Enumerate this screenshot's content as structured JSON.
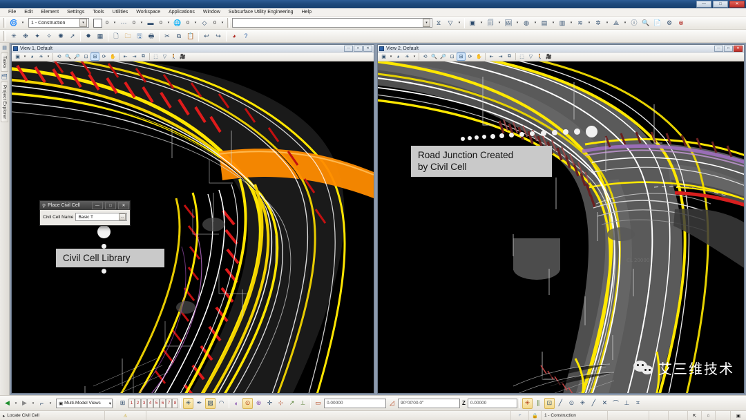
{
  "app": {
    "title": "",
    "window_controls": [
      "—",
      "□",
      "✕"
    ]
  },
  "menubar": {
    "items": [
      {
        "label": "File"
      },
      {
        "label": "Edit"
      },
      {
        "label": "Element"
      },
      {
        "label": "Settings"
      },
      {
        "label": "Tools"
      },
      {
        "label": "Utilities"
      },
      {
        "label": "Workspace"
      },
      {
        "label": "Applications"
      },
      {
        "label": "Window"
      },
      {
        "label": "Subsurface Utility Engineering"
      },
      {
        "label": "Help"
      }
    ]
  },
  "attributes_toolbar": {
    "active_level": "1 - Construction",
    "color_value": "0",
    "style_value": "0",
    "weight_value": "0",
    "class_value": "0",
    "transparency_value": "0",
    "search_value": "",
    "search_placeholder": ""
  },
  "standard_toolbar": {
    "buttons": [
      {
        "name": "element-selection-icon",
        "glyph": "✳"
      },
      {
        "name": "fence-icon",
        "glyph": "❉"
      },
      {
        "name": "select-by-attributes-icon",
        "glyph": "✦"
      },
      {
        "name": "powerselector-icon",
        "glyph": "✧"
      },
      {
        "name": "select-similar-icon",
        "glyph": "✺"
      },
      {
        "name": "pointer-icon",
        "glyph": "➚"
      },
      {
        "name": "pattern-icon",
        "glyph": "✸"
      },
      {
        "name": "grid-icon",
        "glyph": "▦"
      },
      {
        "name": "new-file-icon",
        "glyph": "🗋"
      },
      {
        "name": "open-file-icon",
        "glyph": "🗀"
      },
      {
        "name": "save-icon",
        "glyph": "🖫"
      },
      {
        "name": "print-icon",
        "glyph": "🖶"
      },
      {
        "name": "cut-icon",
        "glyph": "✂"
      },
      {
        "name": "copy-icon",
        "glyph": "⧉"
      },
      {
        "name": "paste-icon",
        "glyph": "📋"
      },
      {
        "name": "undo-icon",
        "glyph": "↩"
      },
      {
        "name": "redo-icon",
        "glyph": "↪"
      },
      {
        "name": "render-icon",
        "glyph": "◕"
      },
      {
        "name": "help-icon",
        "glyph": "?"
      }
    ]
  },
  "primary_toolbar": {
    "buttons": [
      {
        "name": "models-icon",
        "glyph": "▣"
      },
      {
        "name": "references-icon",
        "glyph": "🗐"
      },
      {
        "name": "raster-manager-icon",
        "glyph": "🖼"
      },
      {
        "name": "point-clouds-icon",
        "glyph": "◍"
      },
      {
        "name": "level-manager-icon",
        "glyph": "▤"
      },
      {
        "name": "level-display-icon",
        "glyph": "▥"
      },
      {
        "name": "element-info-icon",
        "glyph": "≋"
      },
      {
        "name": "cell-library-icon",
        "glyph": "✲"
      },
      {
        "name": "design-history-icon",
        "glyph": "⟁"
      },
      {
        "name": "info-icon",
        "glyph": "ⓘ"
      },
      {
        "name": "analyze-icon",
        "glyph": "🔍"
      },
      {
        "name": "report-icon",
        "glyph": "📄"
      },
      {
        "name": "settings-icon",
        "glyph": "⚙"
      },
      {
        "name": "clear-icon",
        "glyph": "⊗"
      }
    ]
  },
  "left_rail": {
    "tabs": [
      {
        "label": "Tasks",
        "icon": "tasks-icon"
      },
      {
        "label": "Project Explorer",
        "icon": "project-explorer-icon"
      }
    ]
  },
  "views": [
    {
      "id": "view1",
      "title": "View 1, Default",
      "controls": [
        "—",
        "□",
        "✕"
      ],
      "close_is_red": false,
      "toolbar": [
        {
          "name": "view-attributes-icon",
          "glyph": "▣"
        },
        {
          "name": "adjust-view-brightness-icon",
          "glyph": "◕"
        },
        {
          "name": "display-style-icon",
          "glyph": "☀"
        },
        {
          "name": "update-view-icon",
          "glyph": "⟲"
        },
        {
          "name": "zoom-in-icon",
          "glyph": "🔍"
        },
        {
          "name": "zoom-out-icon",
          "glyph": "🔎"
        },
        {
          "name": "window-area-icon",
          "glyph": "⊡"
        },
        {
          "name": "fit-view-icon",
          "glyph": "⊞"
        },
        {
          "name": "rotate-view-icon",
          "glyph": "⟳"
        },
        {
          "name": "pan-view-icon",
          "glyph": "✋"
        },
        {
          "name": "view-previous-icon",
          "glyph": "⇤"
        },
        {
          "name": "view-next-icon",
          "glyph": "⇥"
        },
        {
          "name": "copy-view-icon",
          "glyph": "⧉"
        },
        {
          "name": "clip-volume-icon",
          "glyph": "⬚"
        },
        {
          "name": "clip-mask-icon",
          "glyph": "▽"
        },
        {
          "name": "walk-icon",
          "glyph": "🚶"
        },
        {
          "name": "camera-icon",
          "glyph": "🎥"
        }
      ]
    },
    {
      "id": "view2",
      "title": "View 2, Default",
      "controls": [
        "—",
        "□",
        "✕"
      ],
      "close_is_red": true,
      "toolbar": [
        {
          "name": "view-attributes-icon",
          "glyph": "▣"
        },
        {
          "name": "adjust-view-brightness-icon",
          "glyph": "◕"
        },
        {
          "name": "display-style-icon",
          "glyph": "☀"
        },
        {
          "name": "update-view-icon",
          "glyph": "⟲"
        },
        {
          "name": "zoom-in-icon",
          "glyph": "🔍"
        },
        {
          "name": "zoom-out-icon",
          "glyph": "🔎"
        },
        {
          "name": "window-area-icon",
          "glyph": "⊡"
        },
        {
          "name": "fit-view-icon",
          "glyph": "⊞"
        },
        {
          "name": "rotate-view-icon",
          "glyph": "⟳"
        },
        {
          "name": "pan-view-icon",
          "glyph": "✋"
        },
        {
          "name": "view-previous-icon",
          "glyph": "⇤"
        },
        {
          "name": "view-next-icon",
          "glyph": "⇥"
        },
        {
          "name": "copy-view-icon",
          "glyph": "⧉"
        },
        {
          "name": "clip-volume-icon",
          "glyph": "⬚"
        },
        {
          "name": "clip-mask-icon",
          "glyph": "▽"
        },
        {
          "name": "walk-icon",
          "glyph": "🚶"
        },
        {
          "name": "camera-icon",
          "glyph": "🎥"
        }
      ]
    }
  ],
  "dialog": {
    "title": "Place Civil Cell",
    "icon": "civil-cell-icon",
    "minimize": "—",
    "maximize": "□",
    "close": "✕",
    "field_label": "Civil Cell Name",
    "field_value": "Basic T",
    "browse_glyph": "…"
  },
  "callouts": [
    {
      "name": "civil-cell-library-callout",
      "text": "Civil Cell Library"
    },
    {
      "name": "road-junction-callout",
      "text": "Road Junction Created\nby Civil Cell"
    }
  ],
  "watermark": {
    "text": "艾三维技术",
    "icon": "wechat-icon"
  },
  "status_toolbar": {
    "back_glyph": "◀",
    "forward_glyph": "▶",
    "snap_glyph": "⌐",
    "model_selector": "Multi-Model Views",
    "level_numbers": [
      "1",
      "2",
      "3",
      "4",
      "5",
      "6",
      "7",
      "8"
    ],
    "distance_value": "0.00000",
    "angle_value": "90°00'00.0\"",
    "z_label": "Z",
    "z_value": "0.00000",
    "tool_buttons": [
      {
        "name": "attach-icon",
        "glyph": "⊞"
      },
      {
        "name": "element-highlight-icon",
        "glyph": "✳"
      },
      {
        "name": "probe-icon",
        "glyph": "✒"
      },
      {
        "name": "snap-mode-icon",
        "glyph": "▨"
      },
      {
        "name": "nearest-snap-icon",
        "glyph": "◠"
      },
      {
        "name": "keypoint-snap-icon",
        "glyph": "◐"
      },
      {
        "name": "center-snap-icon",
        "glyph": "⊙"
      },
      {
        "name": "origin-snap-icon",
        "glyph": "⊛"
      },
      {
        "name": "bisector-snap-icon",
        "glyph": "✛"
      },
      {
        "name": "intersection-snap-icon",
        "glyph": "⊹"
      },
      {
        "name": "tangent-snap-icon",
        "glyph": "↗"
      },
      {
        "name": "perpendicular-snap-icon",
        "glyph": "⟂"
      },
      {
        "name": "parallel-snap-icon",
        "glyph": "∥"
      },
      {
        "name": "point-on-snap-icon",
        "glyph": "⊡"
      },
      {
        "name": "multi-snap-icon",
        "glyph": "✕"
      },
      {
        "name": "arc-snap-icon",
        "glyph": "⌒"
      },
      {
        "name": "midpoint-snap-icon",
        "glyph": "⊥"
      },
      {
        "name": "element-snap-icon",
        "glyph": "⌗"
      }
    ]
  },
  "message_bar": {
    "prompt_arrow": "▸",
    "prompt": "Locate Civil Cell",
    "warning_icon": "⚠",
    "snap_icon": "⌐",
    "lock_icon": "🔒",
    "active_level": "1 - Construction",
    "right_icons": [
      "⇱",
      "⌂",
      "▣"
    ]
  }
}
